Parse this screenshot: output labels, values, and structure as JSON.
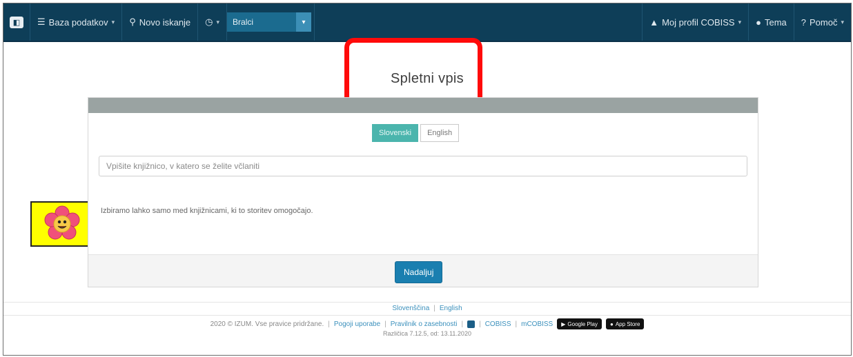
{
  "navbar": {
    "database_label": "Baza podatkov",
    "new_search_label": "Novo iskanje",
    "library_select_value": "Bralci",
    "profile_label": "Moj profil COBISS",
    "theme_label": "Tema",
    "help_label": "Pomoč"
  },
  "page": {
    "title": "Spletni vpis"
  },
  "form": {
    "lang_slovenian": "Slovenski",
    "lang_english": "English",
    "library_placeholder": "Vpišite knjižnico, v katero se želite včlaniti",
    "info_text": "Izbiramo lahko samo med knjižnicami, ki to storitev omogočajo.",
    "continue_label": "Nadaljuj"
  },
  "footer": {
    "lang_slovenian": "Slovenščina",
    "lang_english": "English",
    "copyright": "2020 © IZUM. Vse pravice pridržane.",
    "terms": "Pogoji uporabe",
    "privacy": "Pravilnik o zasebnosti",
    "cobiss": "COBISS",
    "mcobiss": "mCOBISS",
    "google_play": "Google Play",
    "app_store": "App Store",
    "version": "Različica 7.12.5, od: 13.11.2020"
  },
  "colors": {
    "navbar": "#0e3e58",
    "accent": "#4bb5ad",
    "primary_button": "#1a7fb0",
    "highlight": "#ff0a0a",
    "sticker_bg": "#ffff00"
  }
}
